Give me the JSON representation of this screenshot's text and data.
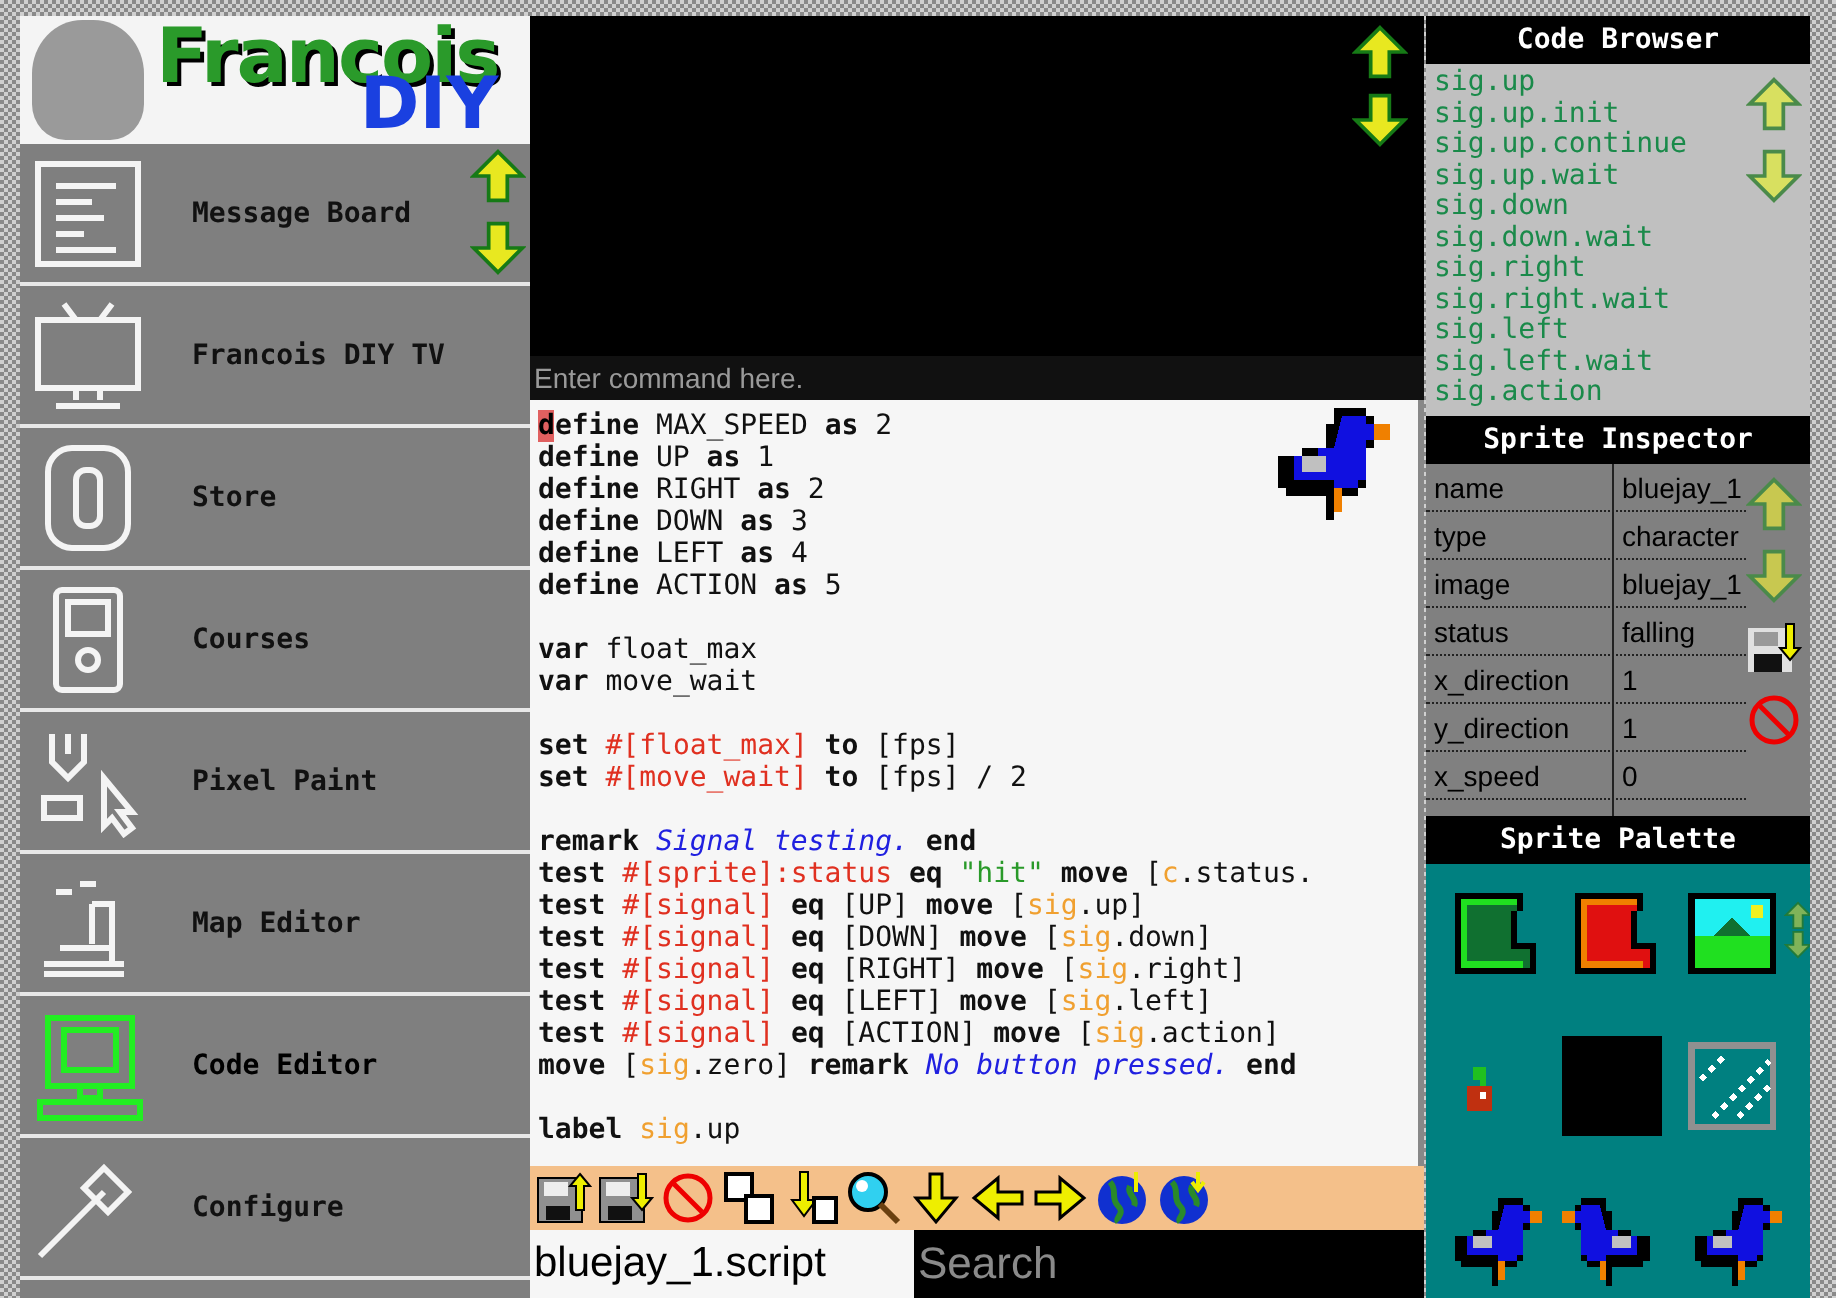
{
  "logo": {
    "title": "Francois",
    "subtitle": "DIY"
  },
  "nav": {
    "items": [
      {
        "label": "Message Board",
        "kind": "board",
        "selected": false
      },
      {
        "label": "Francois DIY TV",
        "kind": "tv",
        "selected": false
      },
      {
        "label": "Store",
        "kind": "coin",
        "selected": false
      },
      {
        "label": "Courses",
        "kind": "handheld",
        "selected": false
      },
      {
        "label": "Pixel Paint",
        "kind": "paint",
        "selected": false
      },
      {
        "label": "Map Editor",
        "kind": "map",
        "selected": false
      },
      {
        "label": "Code Editor",
        "kind": "computer",
        "selected": true
      },
      {
        "label": "Configure",
        "kind": "wrench",
        "selected": false
      }
    ]
  },
  "preview": {
    "command": {
      "placeholder": "Enter command here."
    }
  },
  "editor": {
    "lines": [
      {
        "kind": "code",
        "tokens": [
          {
            "kind": "cursor",
            "text": "d"
          },
          {
            "kind": "keyword",
            "text": "efine"
          },
          {
            "kind": "plain",
            "text": " MAX_SPEED"
          },
          {
            "kind": "keyword",
            "text": " as"
          },
          {
            "kind": "plain",
            "text": " 2"
          }
        ]
      },
      {
        "kind": "code",
        "tokens": [
          {
            "kind": "keyword",
            "text": "define"
          },
          {
            "kind": "plain",
            "text": " UP"
          },
          {
            "kind": "keyword",
            "text": " as"
          },
          {
            "kind": "plain",
            "text": " 1"
          }
        ]
      },
      {
        "kind": "code",
        "tokens": [
          {
            "kind": "keyword",
            "text": "define"
          },
          {
            "kind": "plain",
            "text": " RIGHT"
          },
          {
            "kind": "keyword",
            "text": " as"
          },
          {
            "kind": "plain",
            "text": " 2"
          }
        ]
      },
      {
        "kind": "code",
        "tokens": [
          {
            "kind": "keyword",
            "text": "define"
          },
          {
            "kind": "plain",
            "text": " DOWN"
          },
          {
            "kind": "keyword",
            "text": " as"
          },
          {
            "kind": "plain",
            "text": " 3"
          }
        ]
      },
      {
        "kind": "code",
        "tokens": [
          {
            "kind": "keyword",
            "text": "define"
          },
          {
            "kind": "plain",
            "text": " LEFT"
          },
          {
            "kind": "keyword",
            "text": " as"
          },
          {
            "kind": "plain",
            "text": " 4"
          }
        ]
      },
      {
        "kind": "code",
        "tokens": [
          {
            "kind": "keyword",
            "text": "define"
          },
          {
            "kind": "plain",
            "text": " ACTION"
          },
          {
            "kind": "keyword",
            "text": " as"
          },
          {
            "kind": "plain",
            "text": " 5"
          }
        ]
      },
      {
        "kind": "blank"
      },
      {
        "kind": "code",
        "tokens": [
          {
            "kind": "keyword",
            "text": "var"
          },
          {
            "kind": "plain",
            "text": " float_max"
          }
        ]
      },
      {
        "kind": "code",
        "tokens": [
          {
            "kind": "keyword",
            "text": "var"
          },
          {
            "kind": "plain",
            "text": " move_wait"
          }
        ]
      },
      {
        "kind": "blank"
      },
      {
        "kind": "code",
        "tokens": [
          {
            "kind": "keyword",
            "text": "set"
          },
          {
            "kind": "reference",
            "text": " #[float_max]"
          },
          {
            "kind": "keyword",
            "text": " to"
          },
          {
            "kind": "plain",
            "text": " [fps]"
          }
        ]
      },
      {
        "kind": "code",
        "tokens": [
          {
            "kind": "keyword",
            "text": "set"
          },
          {
            "kind": "reference",
            "text": " #[move_wait]"
          },
          {
            "kind": "keyword",
            "text": " to"
          },
          {
            "kind": "plain",
            "text": " [fps] / 2"
          }
        ]
      },
      {
        "kind": "blank"
      },
      {
        "kind": "code",
        "tokens": [
          {
            "kind": "keyword",
            "text": "remark"
          },
          {
            "kind": "remark",
            "text": " Signal testing."
          },
          {
            "kind": "keyword",
            "text": " end"
          }
        ]
      },
      {
        "kind": "code",
        "tokens": [
          {
            "kind": "keyword",
            "text": "test"
          },
          {
            "kind": "reference",
            "text": " #[sprite]:status"
          },
          {
            "kind": "keyword",
            "text": " eq"
          },
          {
            "kind": "string",
            "text": " \"hit\""
          },
          {
            "kind": "keyword",
            "text": " move"
          },
          {
            "kind": "plain",
            "text": " ["
          },
          {
            "kind": "signal",
            "text": "c"
          },
          {
            "kind": "plain",
            "text": ".status."
          }
        ]
      },
      {
        "kind": "code",
        "tokens": [
          {
            "kind": "keyword",
            "text": "test"
          },
          {
            "kind": "reference",
            "text": " #[signal]"
          },
          {
            "kind": "keyword",
            "text": " eq"
          },
          {
            "kind": "plain",
            "text": " [UP]"
          },
          {
            "kind": "keyword",
            "text": " move"
          },
          {
            "kind": "plain",
            "text": " ["
          },
          {
            "kind": "signal",
            "text": "sig"
          },
          {
            "kind": "plain",
            "text": ".up]"
          }
        ]
      },
      {
        "kind": "code",
        "tokens": [
          {
            "kind": "keyword",
            "text": "test"
          },
          {
            "kind": "reference",
            "text": " #[signal]"
          },
          {
            "kind": "keyword",
            "text": " eq"
          },
          {
            "kind": "plain",
            "text": " [DOWN]"
          },
          {
            "kind": "keyword",
            "text": " move"
          },
          {
            "kind": "plain",
            "text": " ["
          },
          {
            "kind": "signal",
            "text": "sig"
          },
          {
            "kind": "plain",
            "text": ".down]"
          }
        ]
      },
      {
        "kind": "code",
        "tokens": [
          {
            "kind": "keyword",
            "text": "test"
          },
          {
            "kind": "reference",
            "text": " #[signal]"
          },
          {
            "kind": "keyword",
            "text": " eq"
          },
          {
            "kind": "plain",
            "text": " [RIGHT]"
          },
          {
            "kind": "keyword",
            "text": " move"
          },
          {
            "kind": "plain",
            "text": " ["
          },
          {
            "kind": "signal",
            "text": "sig"
          },
          {
            "kind": "plain",
            "text": ".right]"
          }
        ]
      },
      {
        "kind": "code",
        "tokens": [
          {
            "kind": "keyword",
            "text": "test"
          },
          {
            "kind": "reference",
            "text": " #[signal]"
          },
          {
            "kind": "keyword",
            "text": " eq"
          },
          {
            "kind": "plain",
            "text": " [LEFT]"
          },
          {
            "kind": "keyword",
            "text": " move"
          },
          {
            "kind": "plain",
            "text": " ["
          },
          {
            "kind": "signal",
            "text": "sig"
          },
          {
            "kind": "plain",
            "text": ".left]"
          }
        ]
      },
      {
        "kind": "code",
        "tokens": [
          {
            "kind": "keyword",
            "text": "test"
          },
          {
            "kind": "reference",
            "text": " #[signal]"
          },
          {
            "kind": "keyword",
            "text": " eq"
          },
          {
            "kind": "plain",
            "text": " [ACTION]"
          },
          {
            "kind": "keyword",
            "text": " move"
          },
          {
            "kind": "plain",
            "text": " ["
          },
          {
            "kind": "signal",
            "text": "sig"
          },
          {
            "kind": "plain",
            "text": ".action]"
          }
        ]
      },
      {
        "kind": "code",
        "tokens": [
          {
            "kind": "keyword",
            "text": "move"
          },
          {
            "kind": "plain",
            "text": " ["
          },
          {
            "kind": "signal",
            "text": "sig"
          },
          {
            "kind": "plain",
            "text": ".zero]"
          },
          {
            "kind": "keyword",
            "text": " remark"
          },
          {
            "kind": "remark",
            "text": " No button pressed."
          },
          {
            "kind": "keyword",
            "text": " end"
          }
        ]
      },
      {
        "kind": "blank"
      },
      {
        "kind": "code",
        "tokens": [
          {
            "kind": "keyword",
            "text": "label"
          },
          {
            "kind": "signal",
            "text": " sig"
          },
          {
            "kind": "plain",
            "text": ".up"
          }
        ]
      }
    ]
  },
  "file": {
    "name": "bluejay_1.script"
  },
  "search": {
    "placeholder": "Search"
  },
  "code_browser": {
    "title": "Code Browser",
    "items": [
      "sig.up",
      "sig.up.init",
      "sig.up.continue",
      "sig.up.wait",
      "sig.down",
      "sig.down.wait",
      "sig.right",
      "sig.right.wait",
      "sig.left",
      "sig.left.wait",
      "sig.action"
    ]
  },
  "sprite_inspector": {
    "title": "Sprite Inspector",
    "rows": [
      {
        "key": "name",
        "value": "bluejay_1"
      },
      {
        "key": "type",
        "value": "character"
      },
      {
        "key": "image",
        "value": "bluejay_1"
      },
      {
        "key": "status",
        "value": "falling"
      },
      {
        "key": "x_direction",
        "value": "1"
      },
      {
        "key": "y_direction",
        "value": "1"
      },
      {
        "key": "x_speed",
        "value": "0"
      }
    ]
  },
  "sprite_palette": {
    "title": "Sprite Palette"
  }
}
